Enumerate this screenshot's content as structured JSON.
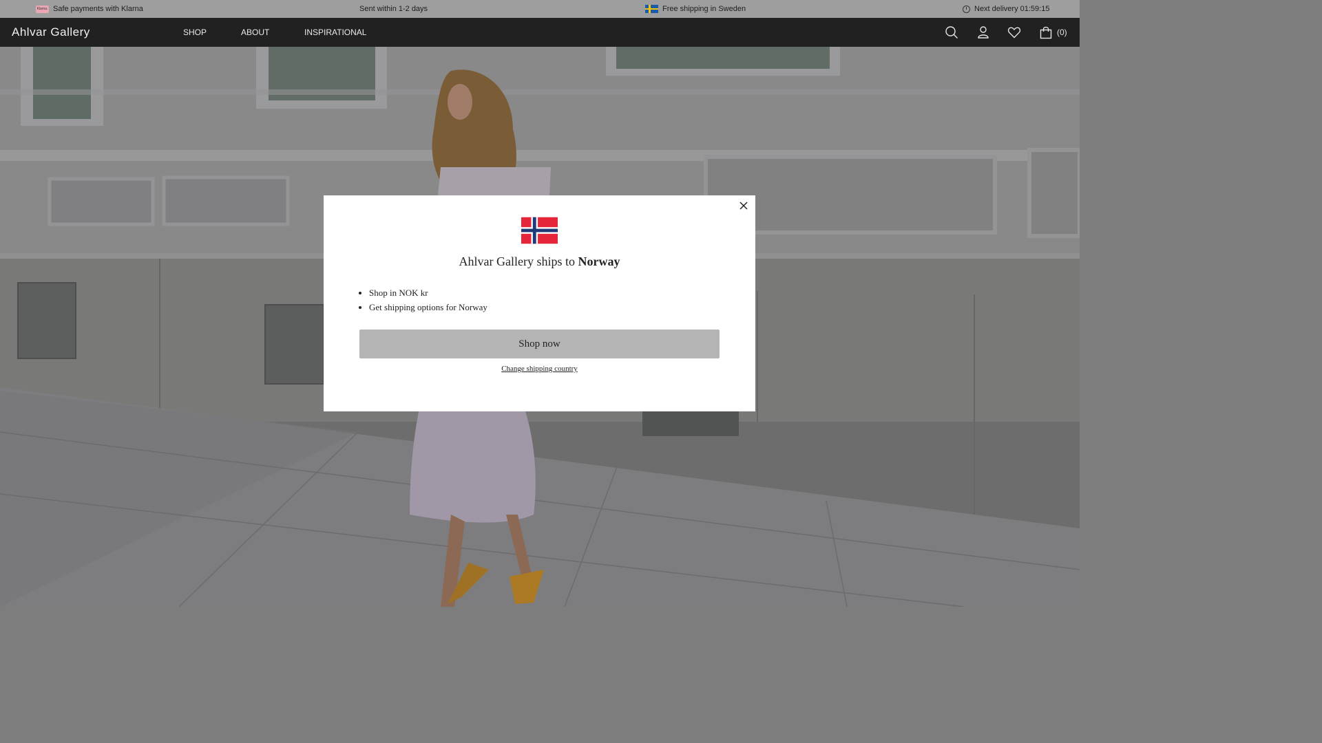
{
  "topbar": {
    "klarna_badge": "Klarna.",
    "payments": "Safe payments with Klarna",
    "sent": "Sent within 1-2 days",
    "shipping": "Free shipping in Sweden",
    "delivery": "Next delivery 01:59:15"
  },
  "header": {
    "logo": "Ahlvar Gallery",
    "nav": [
      "SHOP",
      "ABOUT",
      "INSPIRATIONAL"
    ],
    "cart_count": "(0)",
    "icons": [
      "search-icon",
      "account-icon",
      "wishlist-heart-icon",
      "shopping-bag-icon"
    ]
  },
  "modal": {
    "title_prefix": "Ahlvar Gallery ships to",
    "country": "Norway",
    "benefits": [
      "Shop in NOK kr",
      "Get shipping options for Norway"
    ],
    "shop_button": "Shop now",
    "change_link": "Change shipping country"
  },
  "colors": {
    "header_bg": "#222121",
    "topbar_bg": "#9e9e9e",
    "button_bg": "#b4b4b4"
  }
}
